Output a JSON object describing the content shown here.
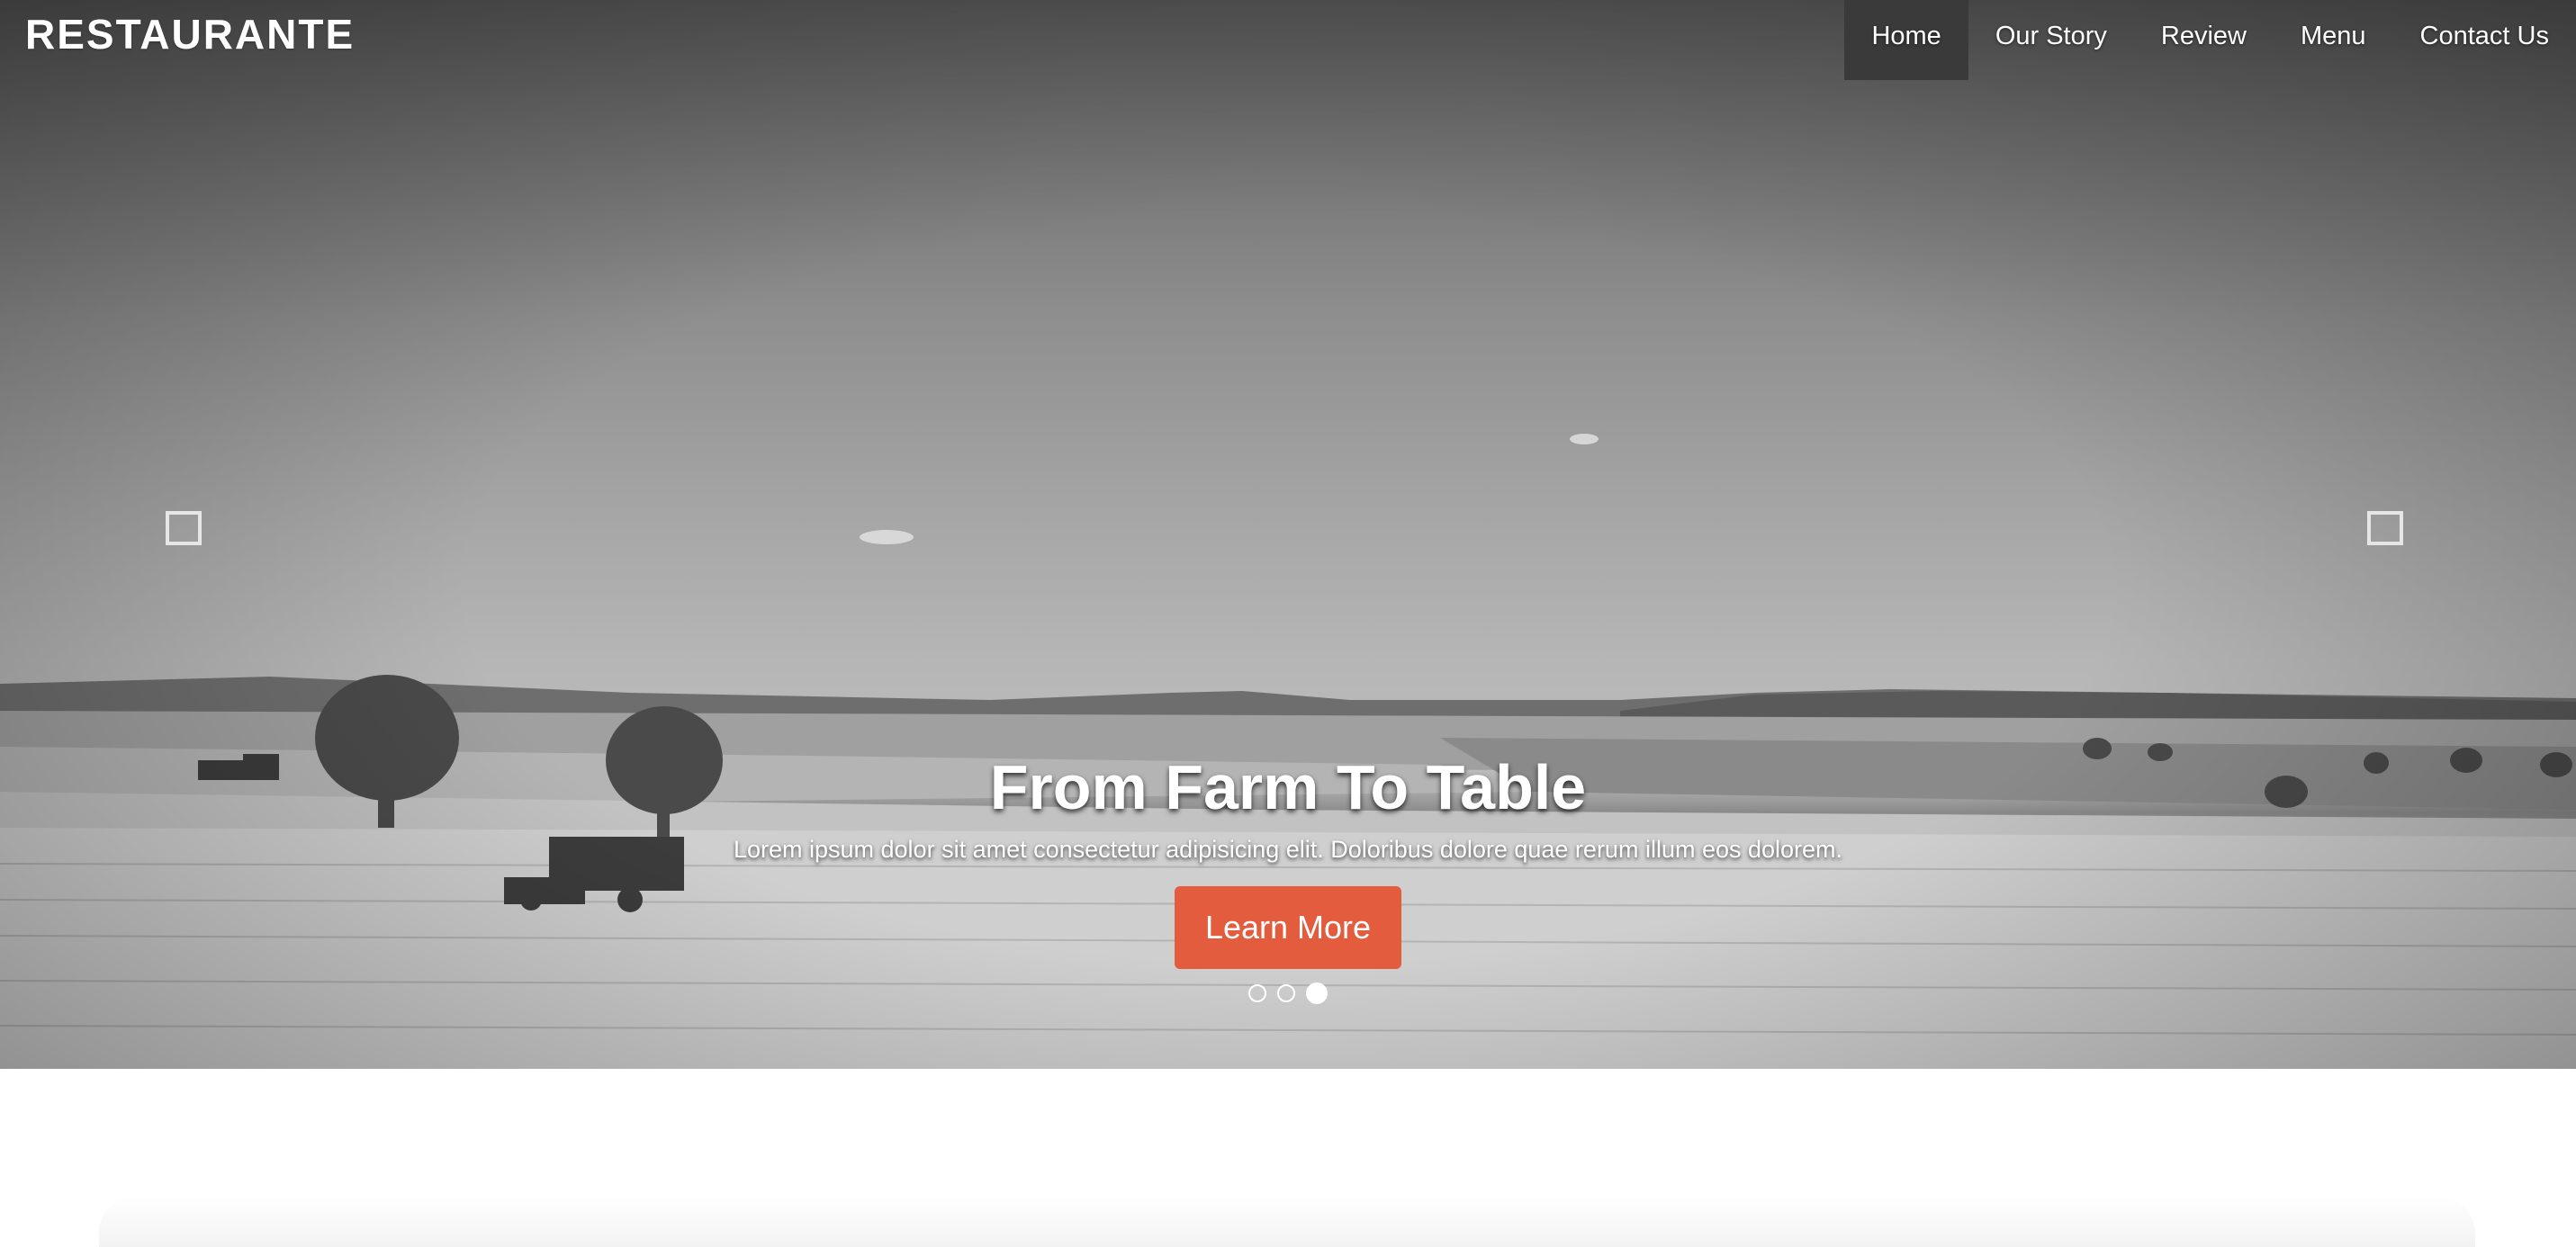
{
  "brand": {
    "logo_text": "RESTAURANTE"
  },
  "nav": {
    "items": [
      {
        "label": "Home",
        "active": true
      },
      {
        "label": "Our Story",
        "active": false
      },
      {
        "label": "Review",
        "active": false
      },
      {
        "label": "Menu",
        "active": false
      },
      {
        "label": "Contact Us",
        "active": false
      }
    ]
  },
  "hero": {
    "headline": "From Farm To Table",
    "subline": "Lorem ipsum dolor sit amet consectetur adipisicing elit. Doloribus dolore quae rerum illum eos dolorem.",
    "cta_label": "Learn More",
    "slides_total": 3,
    "active_slide": 3
  },
  "controls": {
    "prev_icon": "square-prev-icon",
    "next_icon": "square-next-icon"
  },
  "colors": {
    "accent": "#e35c3d",
    "nav_active_bg": "#3a3a3a",
    "text_light": "#ffffff"
  }
}
